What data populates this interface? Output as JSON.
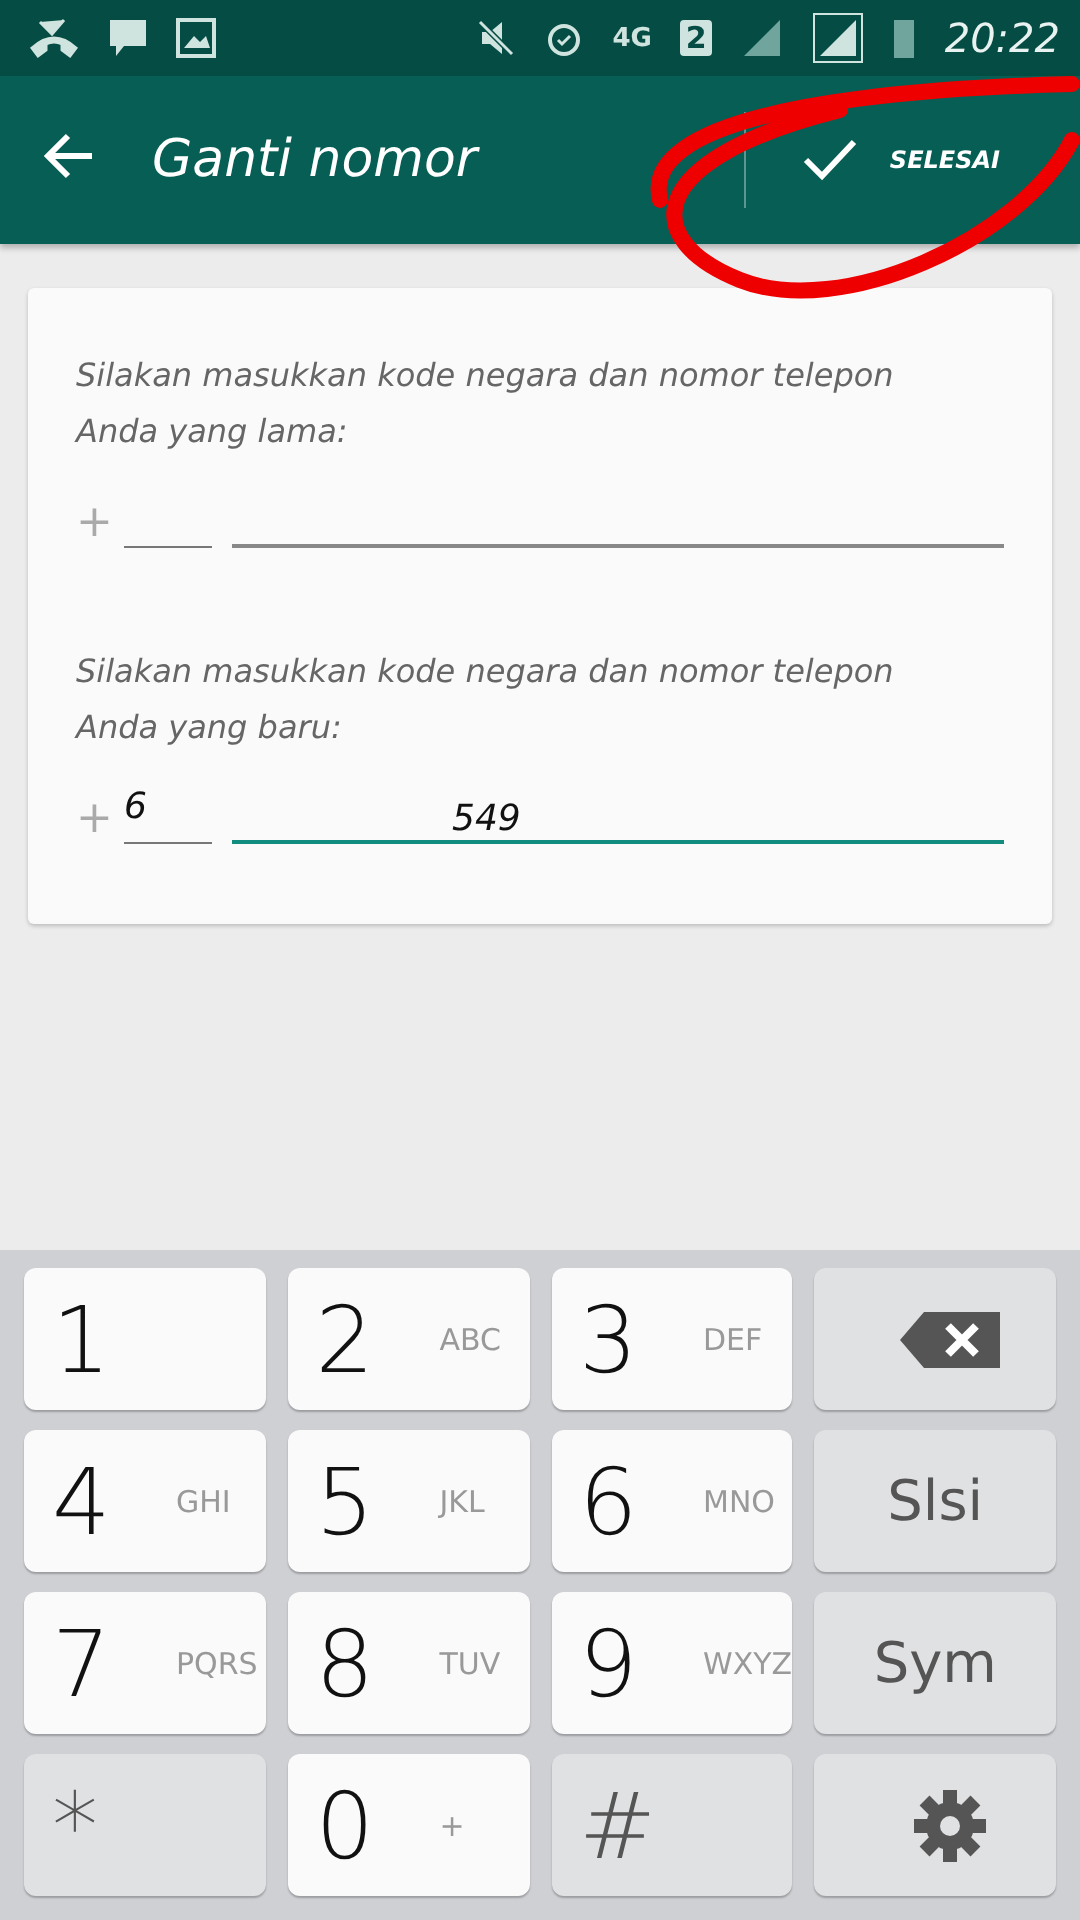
{
  "status_bar": {
    "time": "20:22",
    "network": "4G",
    "sim": "2"
  },
  "app_bar": {
    "title": "Ganti nomor",
    "action": "SELESAI"
  },
  "form": {
    "fields": [
      {
        "label": "Silakan masukkan kode negara dan nomor telepon Anda yang lama:",
        "prefix": "+",
        "focused": false
      },
      {
        "label": "Silakan masukkan kode negara dan nomor telepon Anda yang baru:",
        "prefix": "+",
        "value_start": "6",
        "value_end": "549",
        "focused": true
      }
    ]
  },
  "keypad": {
    "keys": [
      {
        "kind": "digit",
        "label": "1"
      },
      {
        "kind": "digit",
        "label": "2",
        "letters": "ABC"
      },
      {
        "kind": "digit",
        "label": "3",
        "letters": "DEF"
      },
      {
        "kind": "backspace"
      },
      {
        "kind": "digit",
        "label": "4",
        "letters": "GHI"
      },
      {
        "kind": "digit",
        "label": "5",
        "letters": "JKL"
      },
      {
        "kind": "digit",
        "label": "6",
        "letters": "MNO"
      },
      {
        "kind": "function",
        "label": "Slsi"
      },
      {
        "kind": "digit",
        "label": "7",
        "letters": "PQRS"
      },
      {
        "kind": "digit",
        "label": "8",
        "letters": "TUV"
      },
      {
        "kind": "digit",
        "label": "9",
        "letters": "WXYZ"
      },
      {
        "kind": "function",
        "label": "Sym"
      },
      {
        "kind": "symbol",
        "label": "*"
      },
      {
        "kind": "digit",
        "label": "0",
        "letters": "+"
      },
      {
        "kind": "symbol",
        "label": "#"
      },
      {
        "kind": "settings"
      }
    ]
  }
}
